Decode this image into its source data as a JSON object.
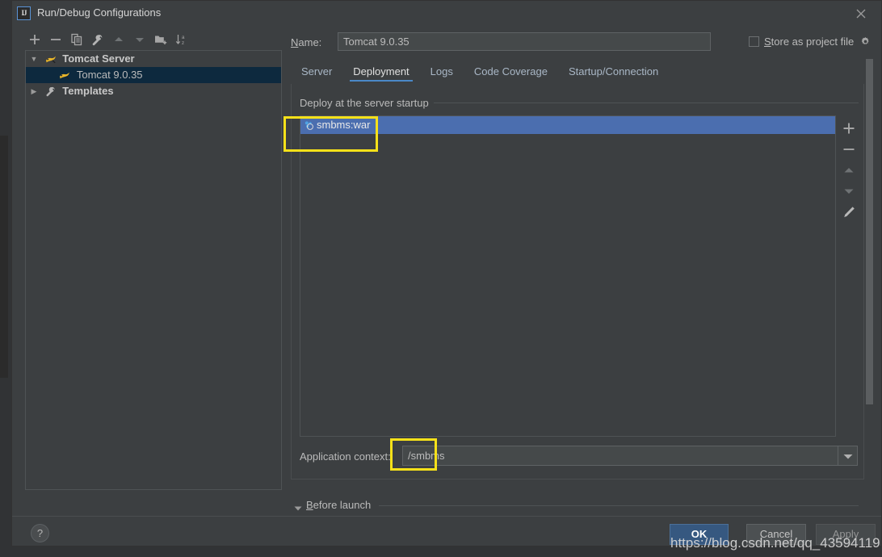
{
  "window": {
    "title": "Run/Debug Configurations",
    "app_icon": "IJ",
    "close_icon": "close-icon"
  },
  "left_toolbar": {
    "buttons": [
      {
        "name": "add-configuration-button",
        "icon": "plus-icon"
      },
      {
        "name": "remove-configuration-button",
        "icon": "minus-icon"
      },
      {
        "name": "copy-configuration-button",
        "icon": "copy-icon"
      },
      {
        "name": "edit-templates-button",
        "icon": "wrench-icon"
      },
      {
        "name": "move-up-button",
        "icon": "arrow-up-icon"
      },
      {
        "name": "move-down-button",
        "icon": "arrow-down-icon"
      },
      {
        "name": "create-folder-button",
        "icon": "folder-add-icon"
      },
      {
        "name": "sort-configurations-button",
        "icon": "sort-az-icon"
      }
    ]
  },
  "tree": {
    "items": [
      {
        "label": "Tomcat Server",
        "icon": "tomcat-icon",
        "expanded": true,
        "twisty": "▼",
        "depth": 0,
        "bold": true,
        "selected": false
      },
      {
        "label": "Tomcat 9.0.35",
        "icon": "tomcat-icon",
        "expanded": false,
        "twisty": "",
        "depth": 1,
        "bold": false,
        "selected": true
      },
      {
        "label": "Templates",
        "icon": "wrench-icon",
        "expanded": false,
        "twisty": "▶",
        "depth": 0,
        "bold": true,
        "selected": false
      }
    ]
  },
  "help": {
    "label": "?"
  },
  "name_field": {
    "label": "Name:",
    "label_mnemonic": "N",
    "label_rest": "ame:",
    "value": "Tomcat 9.0.35",
    "placeholder": ""
  },
  "store_as_project_file": {
    "label": "Store as project file",
    "label_mnemonic": "S",
    "label_rest": "tore as project file",
    "checked": false,
    "gear_icon": "gear-icon"
  },
  "tabs": {
    "active": "Deployment",
    "items": [
      {
        "label": "Server"
      },
      {
        "label": "Deployment"
      },
      {
        "label": "Logs"
      },
      {
        "label": "Code Coverage"
      },
      {
        "label": "Startup/Connection"
      }
    ]
  },
  "deployment": {
    "section_title": "Deploy at the server startup",
    "rows": [
      {
        "label": "smbms:war",
        "icon": "artifact-icon",
        "selected": true
      }
    ],
    "side_buttons": [
      {
        "name": "add-artifact-button",
        "icon": "plus-icon"
      },
      {
        "name": "remove-artifact-button",
        "icon": "minus-icon"
      },
      {
        "name": "move-artifact-up-button",
        "icon": "arrow-up-icon"
      },
      {
        "name": "move-artifact-down-button",
        "icon": "arrow-down-icon"
      },
      {
        "name": "edit-artifact-button",
        "icon": "pencil-icon"
      }
    ]
  },
  "application_context": {
    "label": "Application context:",
    "value": "/smbms",
    "placeholder": "",
    "dropdown_icon": "chevron-down-icon"
  },
  "before_launch": {
    "label": "Before launch",
    "label_mnemonic": "B",
    "label_rest": "efore launch",
    "twisty": "▼",
    "expanded": true
  },
  "buttons": {
    "ok": "OK",
    "cancel": "Cancel",
    "apply": "Apply"
  },
  "watermark": {
    "text": "https://blog.csdn.net/qq_43594119"
  },
  "colors": {
    "dialog_background": "#3c3f41",
    "selection_blue": "#4b6eaf",
    "tree_selection": "#0d293e",
    "accent_tab_underline": "#4a88c7",
    "ok_button": "#365880",
    "annotation_yellow": "#f7e119",
    "text_primary": "#bbbbbb"
  }
}
